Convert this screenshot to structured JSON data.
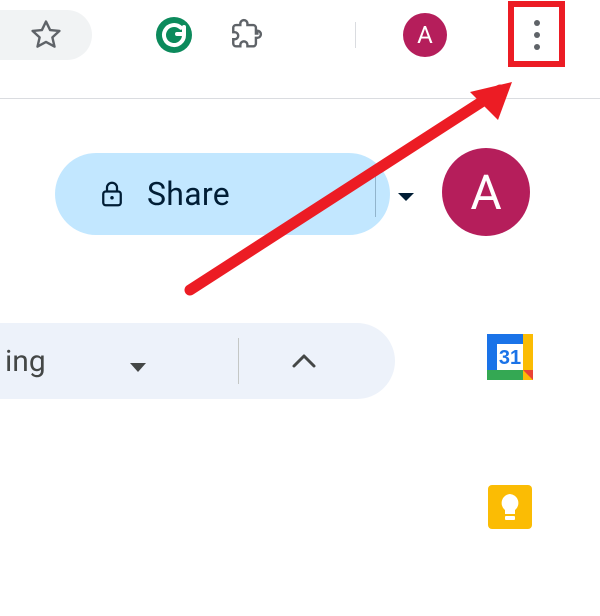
{
  "browser": {
    "avatar_letter": "A",
    "highlight_color": "#ec1c24"
  },
  "app": {
    "share_label": "Share",
    "avatar_letter": "A",
    "mode_label_partial": "ing",
    "calendar_day": "31"
  }
}
